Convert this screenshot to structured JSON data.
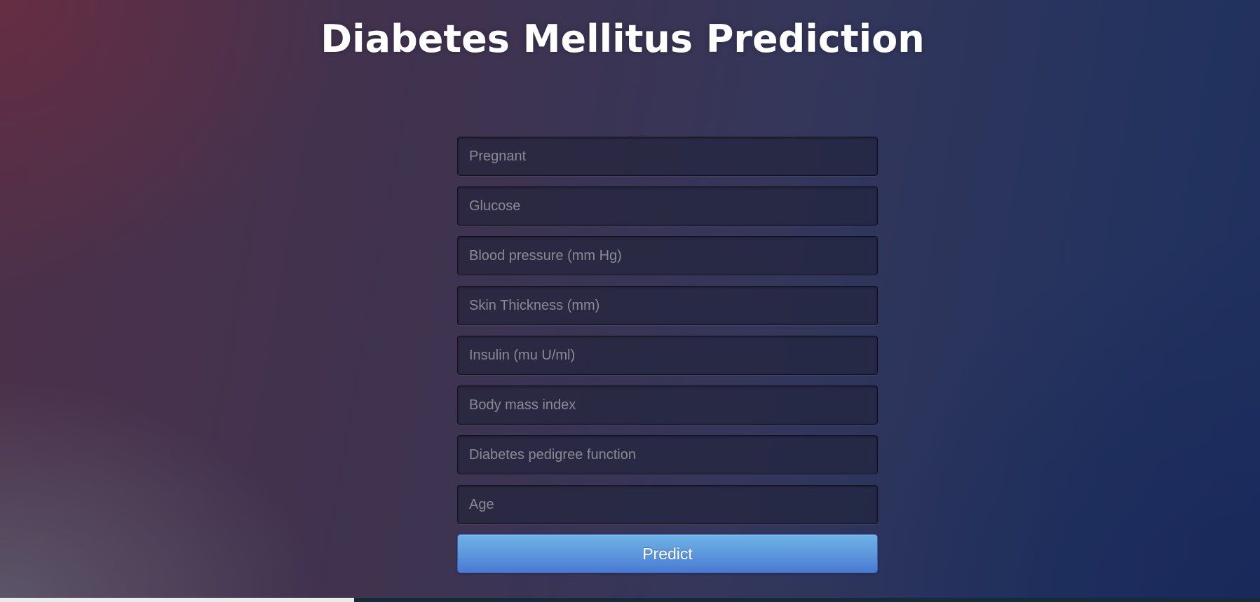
{
  "header": {
    "title": "Diabetes Mellitus Prediction"
  },
  "form": {
    "fields": [
      {
        "placeholder": "Pregnant",
        "value": ""
      },
      {
        "placeholder": "Glucose",
        "value": ""
      },
      {
        "placeholder": "Blood pressure (mm Hg)",
        "value": ""
      },
      {
        "placeholder": "Skin Thickness (mm)",
        "value": ""
      },
      {
        "placeholder": "Insulin (mu U/ml)",
        "value": ""
      },
      {
        "placeholder": "Body mass index",
        "value": ""
      },
      {
        "placeholder": "Diabetes pedigree function",
        "value": ""
      },
      {
        "placeholder": "Age",
        "value": ""
      }
    ],
    "submit_label": "Predict"
  },
  "colors": {
    "button_top": "#6fb2e6",
    "button_bottom": "#4a79d2",
    "title_text": "#ffffff",
    "placeholder_text": "#8a8a96"
  }
}
